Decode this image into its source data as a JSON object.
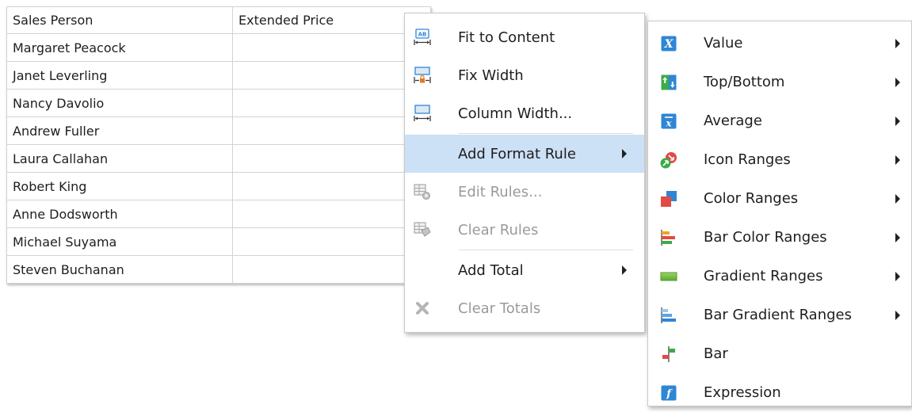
{
  "grid": {
    "headers": [
      "Sales Person",
      "Extended Price"
    ],
    "rows": [
      "Margaret Peacock",
      "Janet Leverling",
      "Nancy Davolio",
      "Andrew Fuller",
      "Laura Callahan",
      "Robert King",
      "Anne Dodsworth",
      "Michael Suyama",
      "Steven Buchanan"
    ]
  },
  "context_menu": {
    "items": [
      {
        "label": "Fit to Content",
        "icon": "fit-to-content-icon",
        "enabled": true
      },
      {
        "label": "Fix Width",
        "icon": "fix-width-icon",
        "enabled": true
      },
      {
        "label": "Column Width...",
        "icon": "column-width-icon",
        "enabled": true
      },
      {
        "label": "Add Format Rule",
        "icon": "",
        "enabled": true,
        "submenu": true,
        "highlighted": true
      },
      {
        "label": "Edit Rules...",
        "icon": "edit-rules-icon",
        "enabled": false
      },
      {
        "label": "Clear Rules",
        "icon": "clear-rules-icon",
        "enabled": false
      },
      {
        "label": "Add Total",
        "icon": "",
        "enabled": true,
        "submenu": true
      },
      {
        "label": "Clear Totals",
        "icon": "clear-totals-icon",
        "enabled": false
      }
    ]
  },
  "format_rule_submenu": {
    "items": [
      {
        "label": "Value",
        "icon": "value-icon",
        "submenu": true
      },
      {
        "label": "Top/Bottom",
        "icon": "top-bottom-icon",
        "submenu": true
      },
      {
        "label": "Average",
        "icon": "average-icon",
        "submenu": true
      },
      {
        "label": "Icon Ranges",
        "icon": "icon-ranges-icon",
        "submenu": true
      },
      {
        "label": "Color Ranges",
        "icon": "color-ranges-icon",
        "submenu": true
      },
      {
        "label": "Bar Color Ranges",
        "icon": "bar-color-ranges-icon",
        "submenu": true
      },
      {
        "label": "Gradient Ranges",
        "icon": "gradient-ranges-icon",
        "submenu": true
      },
      {
        "label": "Bar Gradient Ranges",
        "icon": "bar-gradient-ranges-icon",
        "submenu": true
      },
      {
        "label": "Bar",
        "icon": "bar-icon",
        "submenu": false
      },
      {
        "label": "Expression",
        "icon": "expression-icon",
        "submenu": false
      }
    ]
  },
  "colors": {
    "highlight": "#cce0f6",
    "grid_line": "#d3d3d3",
    "disabled_text": "#9a9a9a",
    "icon_blue": "#2e86d4"
  }
}
